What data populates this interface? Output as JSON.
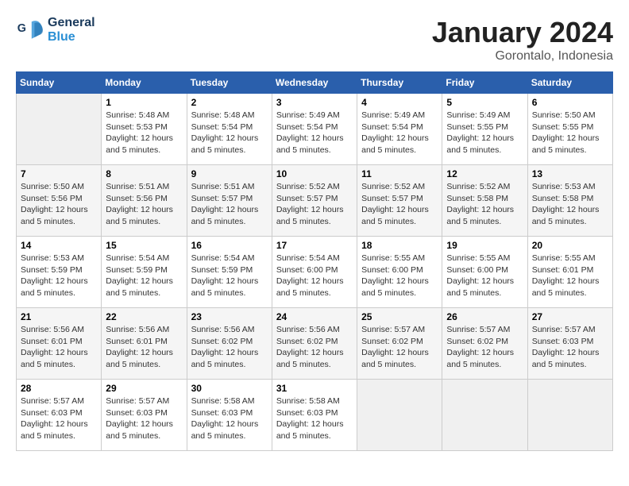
{
  "header": {
    "logo_line1": "General",
    "logo_line2": "Blue",
    "month": "January 2024",
    "location": "Gorontalo, Indonesia"
  },
  "weekdays": [
    "Sunday",
    "Monday",
    "Tuesday",
    "Wednesday",
    "Thursday",
    "Friday",
    "Saturday"
  ],
  "weeks": [
    [
      {
        "day": "",
        "sunrise": "",
        "sunset": "",
        "daylight": ""
      },
      {
        "day": "1",
        "sunrise": "Sunrise: 5:48 AM",
        "sunset": "Sunset: 5:53 PM",
        "daylight": "Daylight: 12 hours and 5 minutes."
      },
      {
        "day": "2",
        "sunrise": "Sunrise: 5:48 AM",
        "sunset": "Sunset: 5:54 PM",
        "daylight": "Daylight: 12 hours and 5 minutes."
      },
      {
        "day": "3",
        "sunrise": "Sunrise: 5:49 AM",
        "sunset": "Sunset: 5:54 PM",
        "daylight": "Daylight: 12 hours and 5 minutes."
      },
      {
        "day": "4",
        "sunrise": "Sunrise: 5:49 AM",
        "sunset": "Sunset: 5:54 PM",
        "daylight": "Daylight: 12 hours and 5 minutes."
      },
      {
        "day": "5",
        "sunrise": "Sunrise: 5:49 AM",
        "sunset": "Sunset: 5:55 PM",
        "daylight": "Daylight: 12 hours and 5 minutes."
      },
      {
        "day": "6",
        "sunrise": "Sunrise: 5:50 AM",
        "sunset": "Sunset: 5:55 PM",
        "daylight": "Daylight: 12 hours and 5 minutes."
      }
    ],
    [
      {
        "day": "7",
        "sunrise": "Sunrise: 5:50 AM",
        "sunset": "Sunset: 5:56 PM",
        "daylight": "Daylight: 12 hours and 5 minutes."
      },
      {
        "day": "8",
        "sunrise": "Sunrise: 5:51 AM",
        "sunset": "Sunset: 5:56 PM",
        "daylight": "Daylight: 12 hours and 5 minutes."
      },
      {
        "day": "9",
        "sunrise": "Sunrise: 5:51 AM",
        "sunset": "Sunset: 5:57 PM",
        "daylight": "Daylight: 12 hours and 5 minutes."
      },
      {
        "day": "10",
        "sunrise": "Sunrise: 5:52 AM",
        "sunset": "Sunset: 5:57 PM",
        "daylight": "Daylight: 12 hours and 5 minutes."
      },
      {
        "day": "11",
        "sunrise": "Sunrise: 5:52 AM",
        "sunset": "Sunset: 5:57 PM",
        "daylight": "Daylight: 12 hours and 5 minutes."
      },
      {
        "day": "12",
        "sunrise": "Sunrise: 5:52 AM",
        "sunset": "Sunset: 5:58 PM",
        "daylight": "Daylight: 12 hours and 5 minutes."
      },
      {
        "day": "13",
        "sunrise": "Sunrise: 5:53 AM",
        "sunset": "Sunset: 5:58 PM",
        "daylight": "Daylight: 12 hours and 5 minutes."
      }
    ],
    [
      {
        "day": "14",
        "sunrise": "Sunrise: 5:53 AM",
        "sunset": "Sunset: 5:59 PM",
        "daylight": "Daylight: 12 hours and 5 minutes."
      },
      {
        "day": "15",
        "sunrise": "Sunrise: 5:54 AM",
        "sunset": "Sunset: 5:59 PM",
        "daylight": "Daylight: 12 hours and 5 minutes."
      },
      {
        "day": "16",
        "sunrise": "Sunrise: 5:54 AM",
        "sunset": "Sunset: 5:59 PM",
        "daylight": "Daylight: 12 hours and 5 minutes."
      },
      {
        "day": "17",
        "sunrise": "Sunrise: 5:54 AM",
        "sunset": "Sunset: 6:00 PM",
        "daylight": "Daylight: 12 hours and 5 minutes."
      },
      {
        "day": "18",
        "sunrise": "Sunrise: 5:55 AM",
        "sunset": "Sunset: 6:00 PM",
        "daylight": "Daylight: 12 hours and 5 minutes."
      },
      {
        "day": "19",
        "sunrise": "Sunrise: 5:55 AM",
        "sunset": "Sunset: 6:00 PM",
        "daylight": "Daylight: 12 hours and 5 minutes."
      },
      {
        "day": "20",
        "sunrise": "Sunrise: 5:55 AM",
        "sunset": "Sunset: 6:01 PM",
        "daylight": "Daylight: 12 hours and 5 minutes."
      }
    ],
    [
      {
        "day": "21",
        "sunrise": "Sunrise: 5:56 AM",
        "sunset": "Sunset: 6:01 PM",
        "daylight": "Daylight: 12 hours and 5 minutes."
      },
      {
        "day": "22",
        "sunrise": "Sunrise: 5:56 AM",
        "sunset": "Sunset: 6:01 PM",
        "daylight": "Daylight: 12 hours and 5 minutes."
      },
      {
        "day": "23",
        "sunrise": "Sunrise: 5:56 AM",
        "sunset": "Sunset: 6:02 PM",
        "daylight": "Daylight: 12 hours and 5 minutes."
      },
      {
        "day": "24",
        "sunrise": "Sunrise: 5:56 AM",
        "sunset": "Sunset: 6:02 PM",
        "daylight": "Daylight: 12 hours and 5 minutes."
      },
      {
        "day": "25",
        "sunrise": "Sunrise: 5:57 AM",
        "sunset": "Sunset: 6:02 PM",
        "daylight": "Daylight: 12 hours and 5 minutes."
      },
      {
        "day": "26",
        "sunrise": "Sunrise: 5:57 AM",
        "sunset": "Sunset: 6:02 PM",
        "daylight": "Daylight: 12 hours and 5 minutes."
      },
      {
        "day": "27",
        "sunrise": "Sunrise: 5:57 AM",
        "sunset": "Sunset: 6:03 PM",
        "daylight": "Daylight: 12 hours and 5 minutes."
      }
    ],
    [
      {
        "day": "28",
        "sunrise": "Sunrise: 5:57 AM",
        "sunset": "Sunset: 6:03 PM",
        "daylight": "Daylight: 12 hours and 5 minutes."
      },
      {
        "day": "29",
        "sunrise": "Sunrise: 5:57 AM",
        "sunset": "Sunset: 6:03 PM",
        "daylight": "Daylight: 12 hours and 5 minutes."
      },
      {
        "day": "30",
        "sunrise": "Sunrise: 5:58 AM",
        "sunset": "Sunset: 6:03 PM",
        "daylight": "Daylight: 12 hours and 5 minutes."
      },
      {
        "day": "31",
        "sunrise": "Sunrise: 5:58 AM",
        "sunset": "Sunset: 6:03 PM",
        "daylight": "Daylight: 12 hours and 5 minutes."
      },
      {
        "day": "",
        "sunrise": "",
        "sunset": "",
        "daylight": ""
      },
      {
        "day": "",
        "sunrise": "",
        "sunset": "",
        "daylight": ""
      },
      {
        "day": "",
        "sunrise": "",
        "sunset": "",
        "daylight": ""
      }
    ]
  ]
}
